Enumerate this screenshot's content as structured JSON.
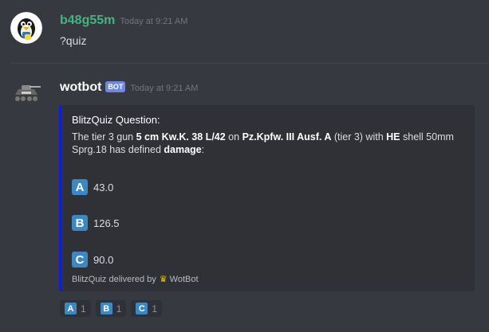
{
  "messages": [
    {
      "username": "b48g55m",
      "username_color": "#43b581",
      "timestamp": "Today at 9:21 AM",
      "text": "?quiz"
    },
    {
      "username": "wotbot",
      "username_color": "#ffffff",
      "bot_tag": "BOT",
      "timestamp": "Today at 9:21 AM"
    }
  ],
  "embed": {
    "accent_color": "#0d1fd9",
    "title": "BlitzQuiz Question:",
    "desc": {
      "p1": "The tier 3 gun ",
      "gun": "5 cm Kw.K. 38 L/42",
      "p2": " on ",
      "tank": "Pz.Kpfw. III Ausf. A",
      "p3": " (tier 3) with ",
      "shell": "HE",
      "p4": " shell 50mm Sprg.18 has defined ",
      "stat": "damage",
      "p5": ":"
    },
    "options": [
      {
        "letter": "A",
        "value": "43.0"
      },
      {
        "letter": "B",
        "value": "126.5"
      },
      {
        "letter": "C",
        "value": "90.0"
      }
    ],
    "footer": {
      "prefix": "BlitzQuiz delivered by",
      "icon": "crown-icon",
      "author": "WotBot"
    }
  },
  "reactions": [
    {
      "letter": "A",
      "count": "1"
    },
    {
      "letter": "B",
      "count": "1"
    },
    {
      "letter": "C",
      "count": "1"
    }
  ]
}
